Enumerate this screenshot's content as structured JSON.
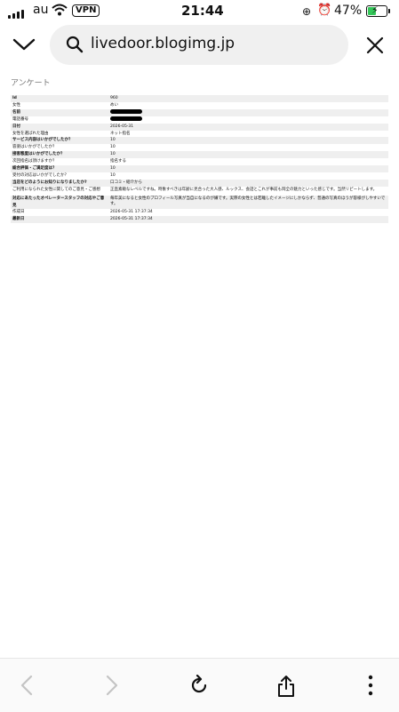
{
  "status": {
    "carrier": "au",
    "vpn": "VPN",
    "time": "21:44",
    "battery_pct": "47%",
    "battery_color": "#34c759"
  },
  "urlbar": {
    "url": "livedoor.blogimg.jp"
  },
  "page": {
    "heading": "アンケート",
    "rows": [
      {
        "key": "Id",
        "value": "960",
        "bold": true
      },
      {
        "key": "女性",
        "value": "めい",
        "bold": false
      },
      {
        "key": "名前",
        "value": "",
        "bold": true,
        "redacted": true
      },
      {
        "key": "電話番号",
        "value": "",
        "bold": false,
        "redacted": true
      },
      {
        "key": "日付",
        "value": "2026-05-31",
        "bold": true
      },
      {
        "key": "女性を選ばれた理由",
        "value": "ネット指名",
        "bold": false
      },
      {
        "key": "サービス内容はいかがでしたか？",
        "value": "10",
        "bold": true
      },
      {
        "key": "容姿はいかがでしたか？",
        "value": "10",
        "bold": false
      },
      {
        "key": "接客態度はいかがでしたか？",
        "value": "10",
        "bold": true
      },
      {
        "key": "次回指名は頂けますか？",
        "value": "指名する",
        "bold": false
      },
      {
        "key": "総合評価・ご満足度は？",
        "value": "10",
        "bold": true
      },
      {
        "key": "受付の対応はいかがでしたか？",
        "value": "10",
        "bold": false
      },
      {
        "key": "当店をどのようにお知りになりましたか?",
        "value": "口コミ・紹介から",
        "bold": true
      },
      {
        "key": "ご利用になられた女性に関してのご意見・ご感想",
        "value": "正直素敵なレベルですね。時象すべきは年齢に見合った大人感、ルックス、会話とこれが事前も岡全の魅力といった感じです。当然リピートします。",
        "bold": false
      },
      {
        "key": "対応にあたったオペレータースタッフの対応やご意見",
        "value": "毎年美になると女性のプロフィール写真が当自になるのが嫌です。実際の女性とは若離したイメージにしかならず、普通の写真のほうが容様がしやすいです。",
        "bold": true
      },
      {
        "key": "作成日",
        "value": "2026-05-31 17:37:34",
        "bold": false
      },
      {
        "key": "最新日",
        "value": "2026-05-31 17:37:34",
        "bold": true
      }
    ]
  }
}
